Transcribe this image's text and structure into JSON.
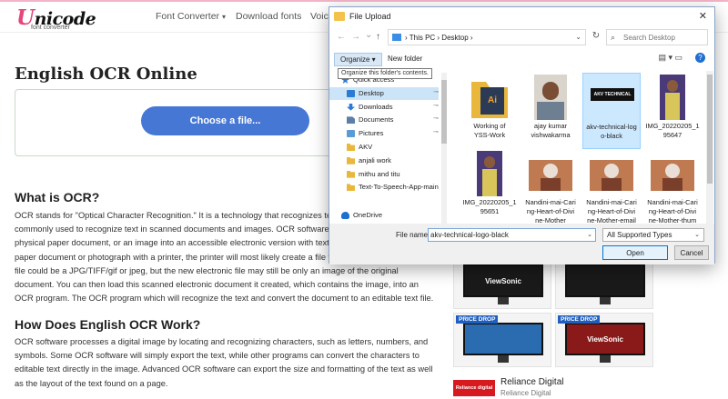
{
  "site": {
    "logo": {
      "initial": "U",
      "rest": "nicode",
      "sub": "font converter"
    },
    "nav": [
      {
        "label": "Font Converter",
        "caret": "▾"
      },
      {
        "label": "Download fonts"
      },
      {
        "label": "Voice"
      }
    ],
    "page_title": "English OCR Online",
    "choose_file_label": "Choose a file...",
    "sections": [
      {
        "heading": "What is OCR?",
        "lines": [
          "OCR stands for \"Optical Character Recognition.\" It is a technology that recognizes text",
          "commonly used to recognize text in scanned documents and images. OCR software",
          "physical paper document, or an image into an accessible electronic version with text",
          "paper document or photograph with a printer, the printer will most likely create a file w",
          "file could be a JPG/TIFF/gif or jpeg, but the new electronic file may still be only an image of the original",
          "document. You can then load this scanned electronic document it created, which contains the image, into an",
          "OCR program. The OCR program which will recognize the text and convert the document to an editable text file."
        ]
      },
      {
        "heading": "How Does English OCR Work?",
        "lines": [
          "OCR software processes a digital image by locating and recognizing characters, such as letters, numbers, and",
          "symbols. Some OCR software will simply export the text, while other programs can convert the characters to",
          "editable text directly in the image. Advanced OCR software can export the size and formatting of the text as well",
          "as the layout of the text found on a page."
        ]
      }
    ],
    "ad": {
      "cards": [
        {
          "badge": "",
          "brand": "ViewSonic"
        },
        {
          "badge": "",
          "brand": ""
        },
        {
          "badge": "PRICE DROP",
          "brand": ""
        },
        {
          "badge": "PRICE DROP",
          "brand": "ViewSonic"
        }
      ],
      "logo_text": "Reliance digital",
      "name": "Reliance Digital",
      "sub": "Reliance Digital"
    }
  },
  "dialog": {
    "title": "File Upload",
    "close": "✕",
    "nav": {
      "back": "←",
      "forward": "→",
      "recent": "⌄",
      "up": "↑"
    },
    "breadcrumb": "›  This PC  ›  Desktop  ›",
    "address_dropdown": "⌄",
    "refresh": "↻",
    "search_placeholder": "Search Desktop",
    "organize_label": "Organize ▾",
    "new_folder_label": "New folder",
    "tooltip": "Organize this folder's contents.",
    "view_icons": "▤ ▾  ▭",
    "help": "?",
    "sidebar": [
      {
        "label": "Quick access",
        "icon": "star-icon",
        "color": "#2a7bd3",
        "pinned": false,
        "selected": false
      },
      {
        "label": "Desktop",
        "icon": "desktop-icon",
        "color": "#2a7bd3",
        "pinned": true,
        "selected": true
      },
      {
        "label": "Downloads",
        "icon": "download-icon",
        "color": "#2a7bd3",
        "pinned": true,
        "selected": false
      },
      {
        "label": "Documents",
        "icon": "document-icon",
        "color": "#5b7fa6",
        "pinned": true,
        "selected": false
      },
      {
        "label": "Pictures",
        "icon": "pictures-icon",
        "color": "#5b9bd5",
        "pinned": true,
        "selected": false
      },
      {
        "label": "AKV",
        "icon": "folder-icon",
        "color": "#e8b73c",
        "pinned": false,
        "selected": false
      },
      {
        "label": "anjali work",
        "icon": "folder-icon",
        "color": "#e8b73c",
        "pinned": false,
        "selected": false
      },
      {
        "label": "mithu and titu",
        "icon": "folder-icon",
        "color": "#e8b73c",
        "pinned": false,
        "selected": false
      },
      {
        "label": "Text-To-Speech-App-main",
        "icon": "folder-icon",
        "color": "#e8b73c",
        "pinned": false,
        "selected": false
      },
      {
        "label": "OneDrive",
        "icon": "cloud-icon",
        "color": "#1f6fd1",
        "pinned": false,
        "selected": false
      }
    ],
    "pin_glyph": "⊸",
    "files": [
      {
        "lines": [
          "Working of",
          "YSS-Work"
        ],
        "thumb": "folder",
        "selected": false
      },
      {
        "lines": [
          "ajay kumar",
          "vishwakarma"
        ],
        "thumb": "portrait",
        "selected": false
      },
      {
        "lines": [
          "akv-technical-log",
          "o-black"
        ],
        "thumb": "logo",
        "logo_text": "AKV TECHNICAL",
        "selected": true
      },
      {
        "lines": [
          "IMG_20220205_1",
          "95647"
        ],
        "thumb": "photo-purple",
        "selected": false
      },
      {
        "lines": [
          "IMG_20220205_1",
          "95651"
        ],
        "thumb": "photo-purple",
        "selected": false
      },
      {
        "lines": [
          "Nandini-mai-Cari",
          "ng-Heart-of-Divi",
          "ne-Mother"
        ],
        "thumb": "photo-elder",
        "selected": false
      },
      {
        "lines": [
          "Nandini-mai-Cari",
          "ng-Heart-of-Divi",
          "ne-Mother-email"
        ],
        "thumb": "photo-elder",
        "selected": false
      },
      {
        "lines": [
          "Nandini-mai-Cari",
          "ng-Heart-of-Divi",
          "ne-Mother-thum"
        ],
        "thumb": "photo-elder",
        "selected": false
      }
    ],
    "file_name_label": "File name:",
    "file_name_value": "akv-technical-logo-black",
    "file_type": "All Supported Types",
    "dropdown_glyph": "⌄",
    "open_label": "Open",
    "cancel_label": "Cancel"
  }
}
